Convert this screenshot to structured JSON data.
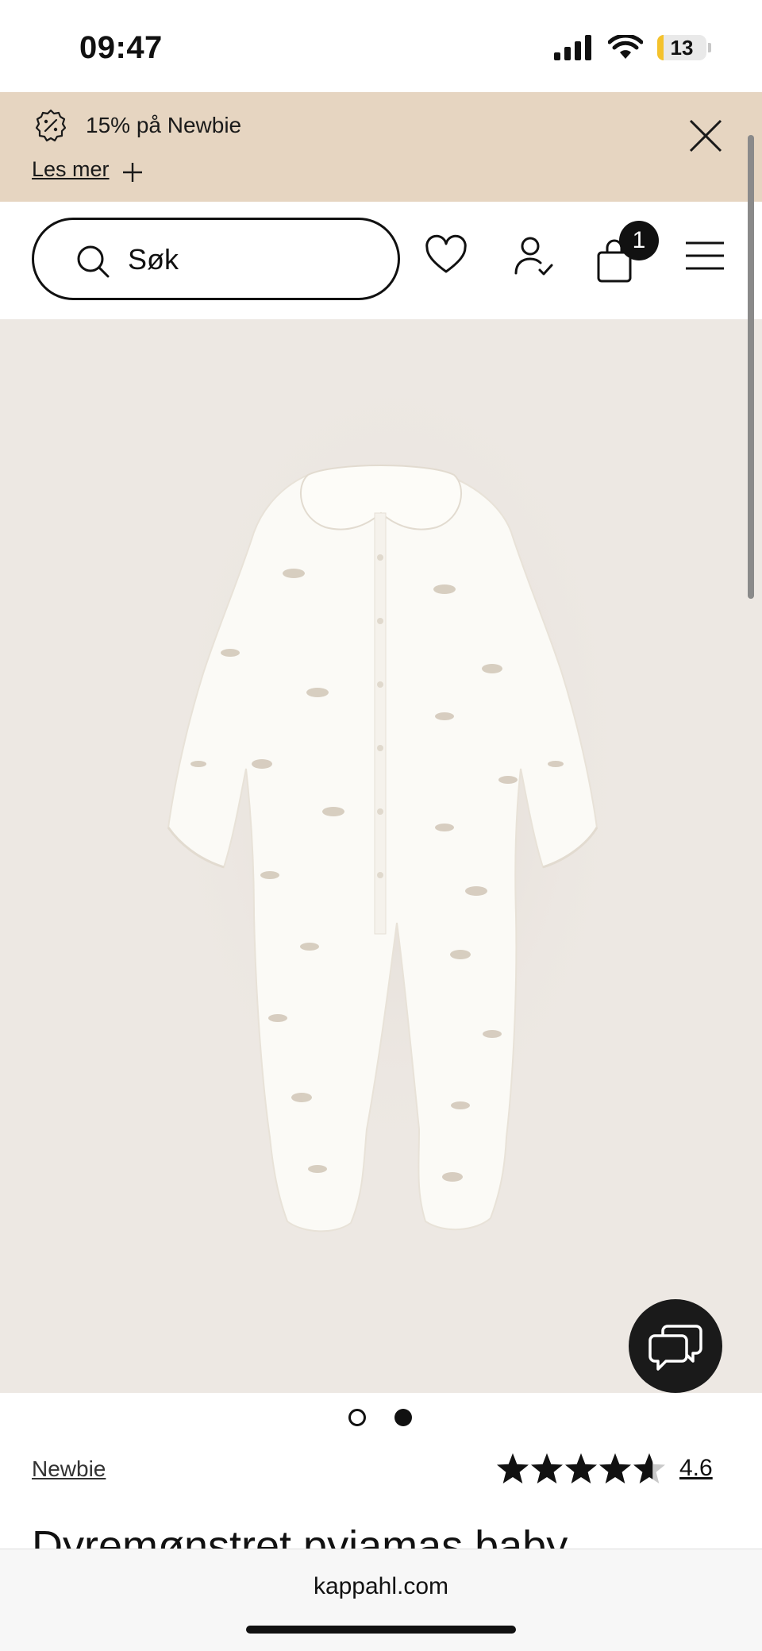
{
  "status_bar": {
    "time": "09:47",
    "battery_level": "13"
  },
  "promo": {
    "text": "15% på Newbie",
    "link_label": "Les mer"
  },
  "header": {
    "search_placeholder": "Søk",
    "cart_count": "1"
  },
  "product": {
    "brand": "Newbie",
    "title": "Dyremønstret pyjamas baby",
    "rating": "4.6",
    "rating_fraction": 0.92
  },
  "carousel": {
    "slide_count": 2,
    "active_index": 1
  },
  "browser": {
    "url": "kappahl.com"
  },
  "colors": {
    "promo_bg": "#e6d5c1",
    "image_bg": "#ede8e3",
    "accent": "#111111",
    "battery_low": "#f4c22c"
  },
  "icons": [
    "signal-icon",
    "wifi-icon",
    "battery-icon",
    "discount-badge-icon",
    "plus-icon",
    "close-icon",
    "search-icon",
    "heart-icon",
    "account-icon",
    "bag-icon",
    "menu-icon",
    "chat-icon",
    "star-icon"
  ]
}
